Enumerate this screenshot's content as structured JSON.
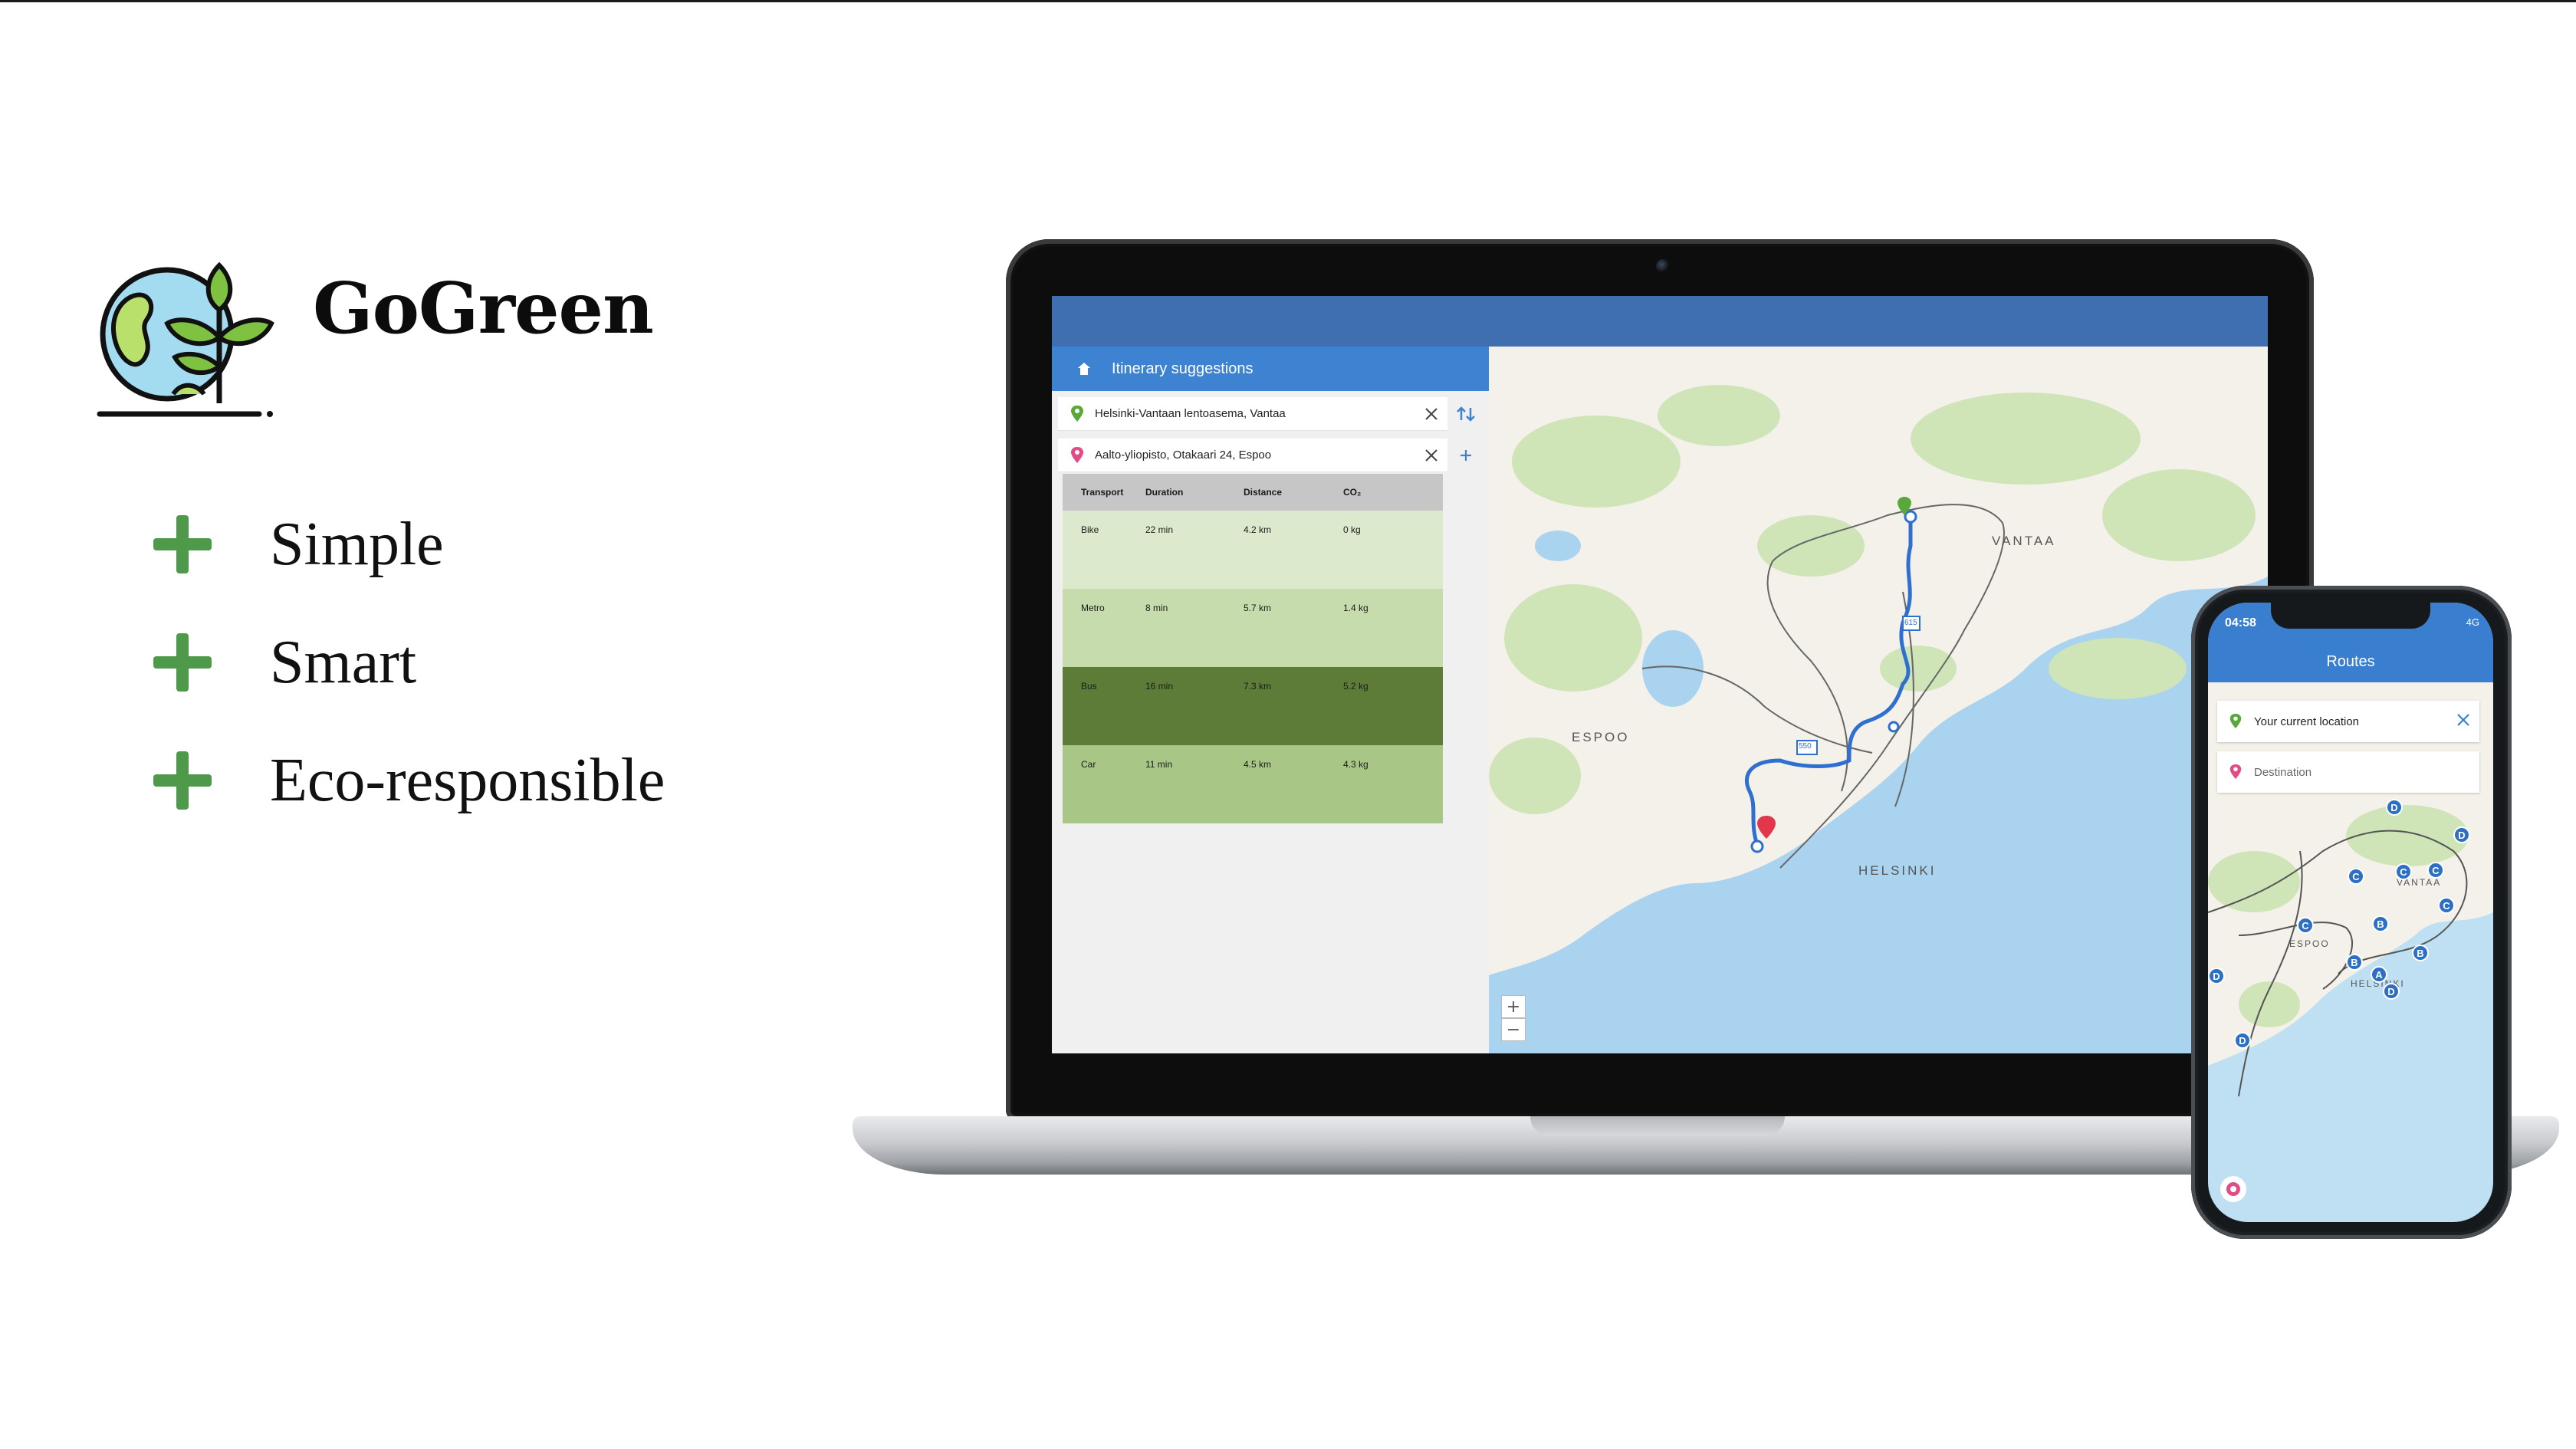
{
  "brand": {
    "name": "GoGreen",
    "features": [
      "Simple",
      "Smart",
      "Eco-responsible"
    ]
  },
  "desktop_app": {
    "panel_title": "Itinerary suggestions",
    "origin": "Helsinki-Vantaan lentoasema, Vantaa",
    "destination": "Aalto-yliopisto, Otakaari 24, Espoo",
    "table": {
      "columns": [
        "Transport",
        "Duration",
        "Distance",
        "CO₂"
      ],
      "rows": [
        {
          "transport": "Bike",
          "duration": "22 min",
          "distance": "4.2 km",
          "co2": "0 kg",
          "color": "#dde9cd"
        },
        {
          "transport": "Metro",
          "duration": "8 min",
          "distance": "5.7 km",
          "co2": "1.4 kg",
          "color": "#c7dcad"
        },
        {
          "transport": "Bus",
          "duration": "16 min",
          "distance": "7.3 km",
          "co2": "5.2 kg",
          "color": "#5c7c38"
        },
        {
          "transport": "Car",
          "duration": "11 min",
          "distance": "4.5 km",
          "co2": "4.3 kg",
          "color": "#a8c786"
        }
      ]
    },
    "map": {
      "cities": [
        "VANTAA",
        "ESPOO",
        "HELSINKI"
      ],
      "road_labels": [
        "615",
        "550"
      ],
      "zoom_in": "+",
      "zoom_out": "−"
    }
  },
  "mobile_app": {
    "time": "04:58",
    "status": "4G",
    "title": "Routes",
    "origin": "Your current location",
    "destination_placeholder": "Destination",
    "cities": [
      "VANTAA",
      "ESPOO",
      "HELSINKI"
    ],
    "stations": [
      "D",
      "D",
      "C",
      "C",
      "C",
      "C",
      "C",
      "B",
      "B",
      "B",
      "A",
      "D",
      "D",
      "D"
    ]
  },
  "colors": {
    "accent_green": "#4e9a4a",
    "app_blue": "#3d83d2",
    "route_blue": "#2f6fd0"
  }
}
